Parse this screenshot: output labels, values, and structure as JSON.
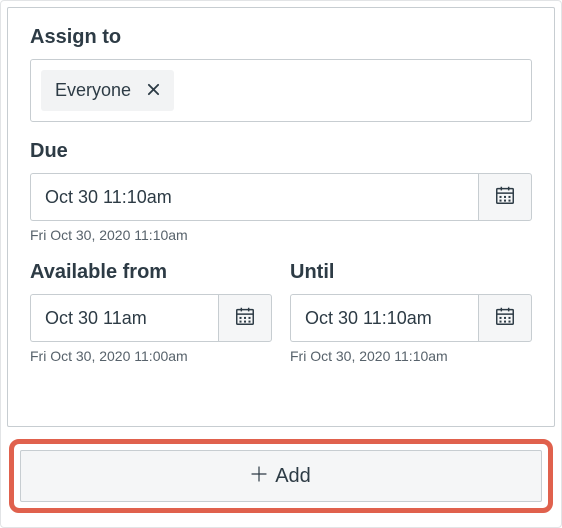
{
  "assign": {
    "label": "Assign to",
    "tokens": [
      {
        "label": "Everyone"
      }
    ]
  },
  "due": {
    "label": "Due",
    "value": "Oct 30 11:10am",
    "hint": "Fri Oct 30, 2020 11:10am"
  },
  "available_from": {
    "label": "Available from",
    "value": "Oct 30 11am",
    "hint": "Fri Oct 30, 2020 11:00am"
  },
  "until": {
    "label": "Until",
    "value": "Oct 30 11:10am",
    "hint": "Fri Oct 30, 2020 11:10am"
  },
  "add": {
    "label": "Add"
  }
}
